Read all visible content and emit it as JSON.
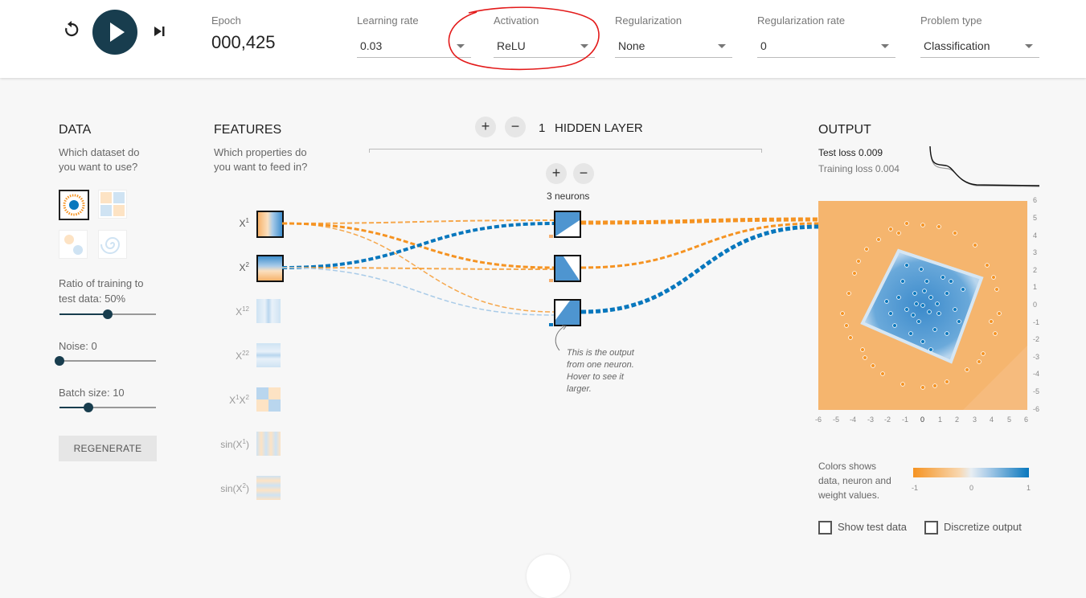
{
  "controls": {
    "epoch_label": "Epoch",
    "epoch_value": "000,425",
    "learning_rate": {
      "label": "Learning rate",
      "value": "0.03"
    },
    "activation": {
      "label": "Activation",
      "value": "ReLU"
    },
    "regularization": {
      "label": "Regularization",
      "value": "None"
    },
    "regularization_rate": {
      "label": "Regularization rate",
      "value": "0"
    },
    "problem_type": {
      "label": "Problem type",
      "value": "Classification"
    }
  },
  "data_panel": {
    "title": "DATA",
    "desc1": "Which dataset do",
    "desc2": "you want to use?",
    "ratio_label1": "Ratio of training to",
    "ratio_label2": "test data:  50%",
    "ratio_value": 0.5,
    "noise_label": "Noise:  0",
    "noise_value": 0,
    "batch_label": "Batch size:  10",
    "batch_value": 0.3,
    "regenerate": "REGENERATE"
  },
  "features_panel": {
    "title": "FEATURES",
    "desc1": "Which properties do",
    "desc2": "you want to feed in?",
    "features": [
      {
        "base": "X",
        "sup": "1",
        "active": true
      },
      {
        "base": "X",
        "sup": "2",
        "active": true
      },
      {
        "base": "X",
        "sup": "12",
        "active": false
      },
      {
        "base": "X",
        "sup": "22",
        "active": false
      },
      {
        "base": "X",
        "sup": "1",
        "base2": "X",
        "sup2": "2",
        "active": false
      },
      {
        "base": "sin(X",
        "sup": "1",
        "tail": ")",
        "active": false
      },
      {
        "base": "sin(X",
        "sup": "2",
        "tail": ")",
        "active": false
      }
    ]
  },
  "network": {
    "hidden_layers_count": "1",
    "hidden_layers_label": "HIDDEN LAYER",
    "neurons_label": "3 neurons",
    "plus": "+",
    "minus": "−",
    "tooltip1": "This is the output",
    "tooltip2": "from one neuron.",
    "tooltip3": "Hover to see it",
    "tooltip4": "larger."
  },
  "output_panel": {
    "title": "OUTPUT",
    "test_loss": "Test loss 0.009",
    "training_loss": "Training loss 0.004",
    "axis_ticks": [
      "-6",
      "-5",
      "-4",
      "-3",
      "-2",
      "-1",
      "0",
      "1",
      "2",
      "3",
      "4",
      "5",
      "6"
    ],
    "colors_desc1": "Colors shows",
    "colors_desc2": "data, neuron and",
    "colors_desc3": "weight values.",
    "scale_min": "-1",
    "scale_mid": "0",
    "scale_max": "1",
    "show_test": "Show test data",
    "discretize": "Discretize output"
  },
  "colors": {
    "orange": "#f59322",
    "blue": "#0877bd",
    "dark": "#183d4e"
  }
}
